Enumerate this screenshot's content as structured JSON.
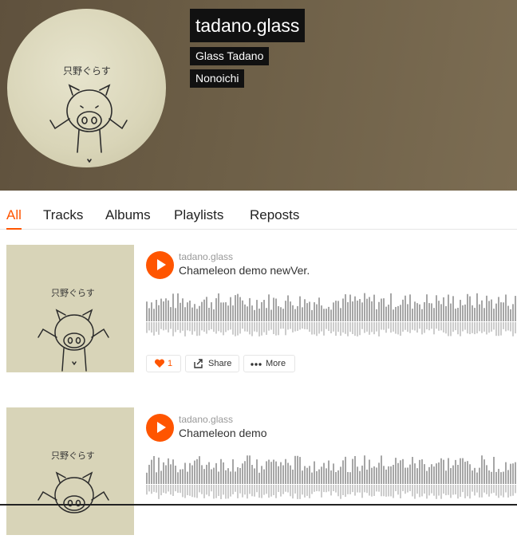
{
  "profile": {
    "username": "tadano.glass",
    "full_name": "Glass Tadano",
    "city": "Nonoichi",
    "avatar_caption": "只野ぐらす"
  },
  "tabs": [
    {
      "label": "All",
      "active": true
    },
    {
      "label": "Tracks",
      "active": false
    },
    {
      "label": "Albums",
      "active": false
    },
    {
      "label": "Playlists",
      "active": false
    },
    {
      "label": "Reposts",
      "active": false
    }
  ],
  "tracks": [
    {
      "uploader": "tadano.glass",
      "title": "Chameleon demo newVer.",
      "artwork_caption": "只野ぐらす",
      "like_count": "1",
      "share_label": "Share",
      "more_label": "More"
    },
    {
      "uploader": "tadano.glass",
      "title": "Chameleon demo",
      "artwork_caption": "只野ぐらす"
    }
  ],
  "colors": {
    "accent": "#ff5500",
    "waveform": "#a6a6a6",
    "name_plate_bg": "#111111",
    "header_bg": "#6d5f47"
  },
  "icons": [
    "play-icon",
    "heart-icon",
    "share-icon",
    "more-icon"
  ]
}
